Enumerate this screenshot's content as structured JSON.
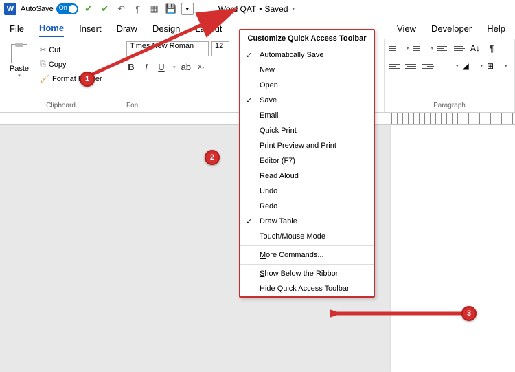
{
  "titlebar": {
    "autosave_label": "AutoSave",
    "autosave_state": "On",
    "doc_title": "Word QAT",
    "doc_status": "Saved"
  },
  "tabs": {
    "file": "File",
    "home": "Home",
    "insert": "Insert",
    "draw": "Draw",
    "design": "Design",
    "layout": "Layout",
    "view": "View",
    "developer": "Developer",
    "help": "Help"
  },
  "ribbon": {
    "clipboard": {
      "paste": "Paste",
      "cut": "Cut",
      "copy": "Copy",
      "format_painter": "Format Painter",
      "label": "Clipboard"
    },
    "font": {
      "name": "Times New Roman",
      "size": "12",
      "label": "Font"
    },
    "paragraph": {
      "label": "Paragraph"
    }
  },
  "qat_menu": {
    "title": "Customize Quick Access Toolbar",
    "items": [
      {
        "label": "Automatically Save",
        "checked": true
      },
      {
        "label": "New",
        "checked": false
      },
      {
        "label": "Open",
        "checked": false
      },
      {
        "label": "Save",
        "checked": true
      },
      {
        "label": "Email",
        "checked": false
      },
      {
        "label": "Quick Print",
        "checked": false
      },
      {
        "label": "Print Preview and Print",
        "checked": false
      },
      {
        "label": "Editor (F7)",
        "checked": false
      },
      {
        "label": "Read Aloud",
        "checked": false
      },
      {
        "label": "Undo",
        "checked": false
      },
      {
        "label": "Redo",
        "checked": false
      },
      {
        "label": "Draw Table",
        "checked": true
      },
      {
        "label": "Touch/Mouse Mode",
        "checked": false
      }
    ],
    "more_commands": "More Commands...",
    "show_below": "Show Below the Ribbon",
    "hide_qat": "Hide Quick Access Toolbar"
  },
  "annotations": {
    "a1": "1",
    "a2": "2",
    "a3": "3"
  }
}
